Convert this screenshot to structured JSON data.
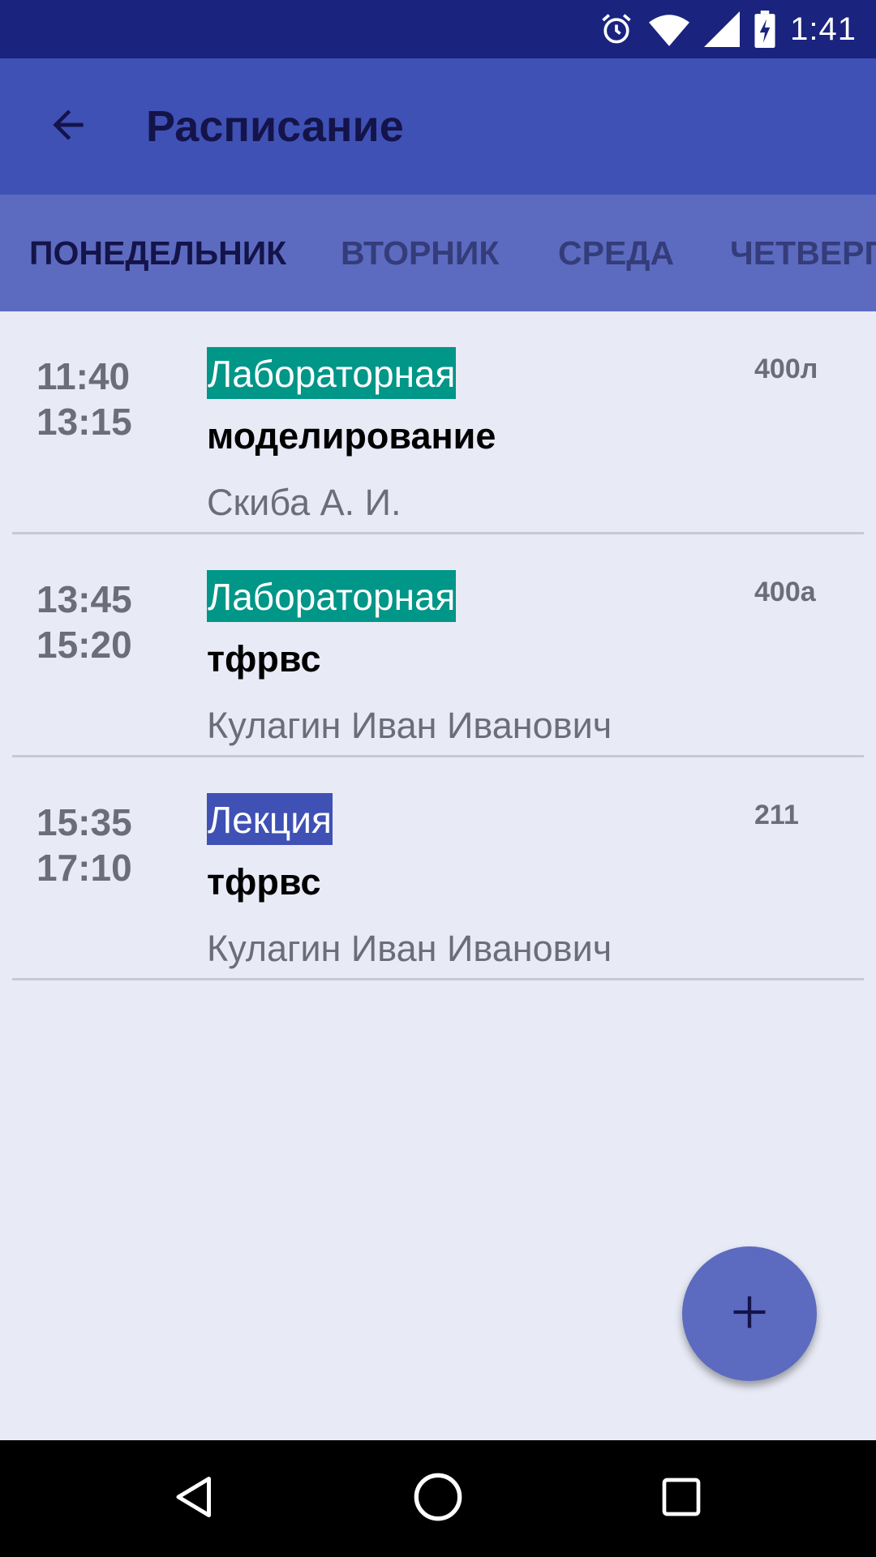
{
  "status_bar": {
    "time": "1:41",
    "icons": [
      "alarm-icon",
      "wifi-icon",
      "signal-icon",
      "battery-charging-icon"
    ]
  },
  "app_bar": {
    "title": "Расписание",
    "back_icon": "arrow-back-icon"
  },
  "tabs": [
    {
      "label": "ПОНЕДЕЛЬНИК",
      "active": true
    },
    {
      "label": "ВТОРНИК",
      "active": false
    },
    {
      "label": "СРЕДА",
      "active": false
    },
    {
      "label": "ЧЕТВЕРГ",
      "active": false
    }
  ],
  "lessons": [
    {
      "start": "11:40",
      "end": "13:15",
      "type": "Лабораторная",
      "type_color": "#009688",
      "subject": "моделирование",
      "teacher": "Скиба А. И.",
      "room": "400л"
    },
    {
      "start": "13:45",
      "end": "15:20",
      "type": "Лабораторная",
      "type_color": "#009688",
      "subject": "тфрвс",
      "teacher": "Кулагин Иван Иванович",
      "room": "400а"
    },
    {
      "start": "15:35",
      "end": "17:10",
      "type": "Лекция",
      "type_color": "#3f51b5",
      "subject": "тфрвс",
      "teacher": "Кулагин Иван Иванович",
      "room": "211"
    }
  ],
  "fab": {
    "icon": "plus-icon"
  },
  "nav_bar": {
    "icons": [
      "back-triangle-icon",
      "home-circle-icon",
      "recents-square-icon"
    ]
  },
  "colors": {
    "status_bar": "#1a237e",
    "app_bar": "#3f51b5",
    "tabs_bar": "#5c6bc0",
    "background": "#e8eaf6",
    "fab": "#5c6bc0"
  }
}
